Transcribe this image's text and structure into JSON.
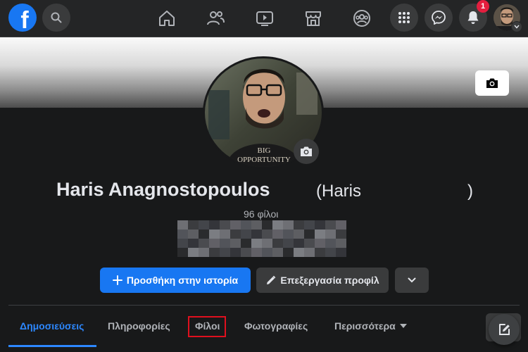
{
  "header": {
    "logo_letter": "f",
    "notification_count": "1",
    "nav_icons": [
      "home-icon",
      "friends-icon",
      "watch-icon",
      "marketplace-icon",
      "groups-icon"
    ],
    "action_icons": [
      "menu-grid-icon",
      "messenger-icon",
      "bell-icon"
    ]
  },
  "profile": {
    "name": "Haris Anagnostopoulos",
    "alt_name_open": "(Haris",
    "alt_name_close": ")",
    "friends_count": "96 φίλοι"
  },
  "actions": {
    "add_story_label": "Προσθήκη στην ιστορία",
    "edit_profile_label": "Επεξεργασία προφίλ"
  },
  "tabs": [
    {
      "label": "Δημοσιεύσεις",
      "active": true
    },
    {
      "label": "Πληροφορίες"
    },
    {
      "label": "Φίλοι",
      "highlighted": true
    },
    {
      "label": "Φωτογραφίες"
    },
    {
      "label": "Περισσότερα"
    }
  ],
  "colors": {
    "accent": "#1877f2",
    "background": "#18191a",
    "surface": "#242526",
    "highlight_box": "#e0101e"
  }
}
